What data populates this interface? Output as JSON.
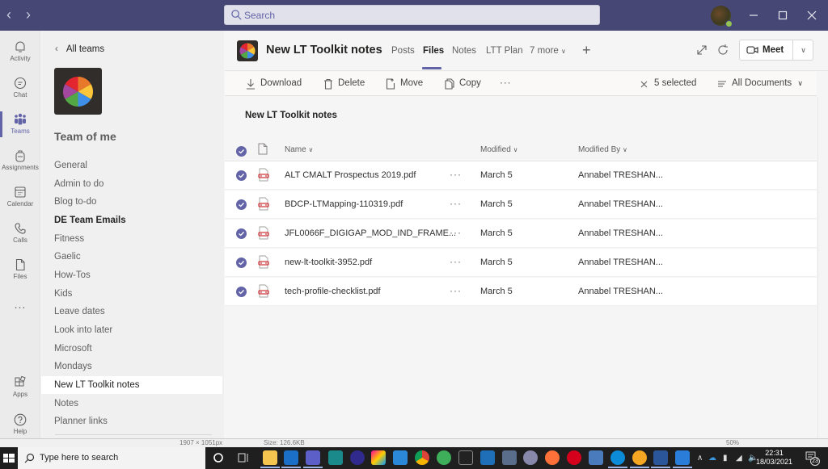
{
  "titlebar": {
    "search_placeholder": "Search"
  },
  "rail": {
    "items": [
      {
        "label": "Activity",
        "icon": "bell-icon"
      },
      {
        "label": "Chat",
        "icon": "chat-icon"
      },
      {
        "label": "Teams",
        "icon": "teams-icon",
        "active": true
      },
      {
        "label": "Assignments",
        "icon": "backpack-icon"
      },
      {
        "label": "Calendar",
        "icon": "calendar-icon"
      },
      {
        "label": "Calls",
        "icon": "phone-icon"
      },
      {
        "label": "Files",
        "icon": "file-icon"
      },
      {
        "label": "...",
        "icon": "more-icon"
      },
      {
        "label": "Apps",
        "icon": "apps-icon"
      },
      {
        "label": "Help",
        "icon": "help-icon"
      }
    ]
  },
  "sidebar": {
    "back_label": "All teams",
    "team_name": "Team of me",
    "channels": [
      {
        "label": "General"
      },
      {
        "label": "Admin to do"
      },
      {
        "label": "Blog to-do"
      },
      {
        "label": "DE Team Emails",
        "bold": true
      },
      {
        "label": "Fitness"
      },
      {
        "label": "Gaelic"
      },
      {
        "label": "How-Tos"
      },
      {
        "label": "Kids"
      },
      {
        "label": "Leave dates"
      },
      {
        "label": "Look into later"
      },
      {
        "label": "Microsoft"
      },
      {
        "label": "Mondays"
      },
      {
        "label": "New LT Toolkit notes",
        "active": true
      },
      {
        "label": "Notes"
      },
      {
        "label": "Planner links"
      }
    ]
  },
  "channel_header": {
    "title": "New LT Toolkit notes",
    "tabs": [
      {
        "label": "Posts"
      },
      {
        "label": "Files",
        "active": true
      },
      {
        "label": "Notes"
      },
      {
        "label": "LTT Plan"
      },
      {
        "label": "7 more"
      }
    ],
    "meet_label": "Meet"
  },
  "command_bar": {
    "download": "Download",
    "delete": "Delete",
    "move": "Move",
    "copy": "Copy",
    "more": "···",
    "selected": "5 selected",
    "view": "All Documents"
  },
  "library": {
    "title": "New LT Toolkit notes",
    "columns": {
      "name": "Name",
      "modified": "Modified",
      "modified_by": "Modified By"
    },
    "files": [
      {
        "name": "ALT CMALT Prospectus 2019.pdf",
        "modified": "March 5",
        "modified_by": "Annabel TRESHAN...",
        "selected": true
      },
      {
        "name": "BDCP-LTMapping-110319.pdf",
        "modified": "March 5",
        "modified_by": "Annabel TRESHAN...",
        "selected": true
      },
      {
        "name": "JFL0066F_DIGIGAP_MOD_IND_FRAME...",
        "modified": "March 5",
        "modified_by": "Annabel TRESHAN...",
        "selected": true
      },
      {
        "name": "new-lt-toolkit-3952.pdf",
        "modified": "March 5",
        "modified_by": "Annabel TRESHAN...",
        "selected": true
      },
      {
        "name": "tech-profile-checklist.pdf",
        "modified": "March 5",
        "modified_by": "Annabel TRESHAN...",
        "selected": true
      }
    ]
  },
  "background_window": {
    "dimensions": "1907 × 1051px",
    "size": "Size: 126.6KB",
    "zoom": "50%"
  },
  "taskbar": {
    "search_placeholder": "Type here to search",
    "time": "22:31",
    "date": "18/03/2021",
    "notification_count": "23"
  },
  "colors": {
    "brand": "#464775",
    "accent": "#6264a7",
    "pdf_red": "#d13438"
  }
}
